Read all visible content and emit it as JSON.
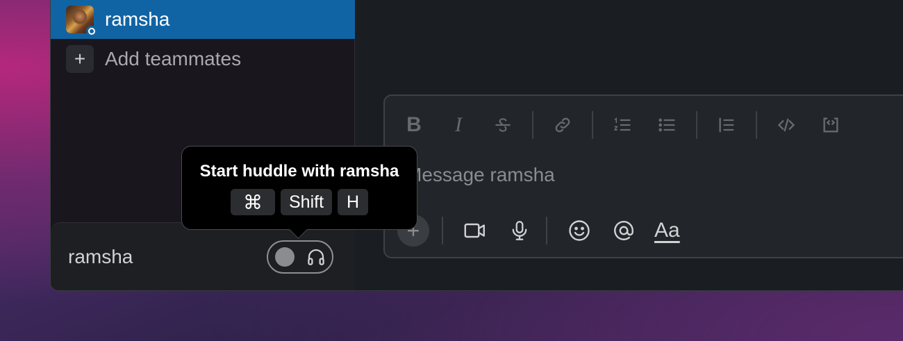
{
  "sidebar": {
    "active_dm": {
      "name": "ramsha"
    },
    "add_teammates_label": "Add teammates",
    "add_icon": "+"
  },
  "footer": {
    "user_name": "ramsha",
    "huddle_toggle_state": "off"
  },
  "tooltip": {
    "title": "Start huddle with ramsha",
    "keys": [
      "⌘",
      "Shift",
      "H"
    ]
  },
  "composer": {
    "placeholder": "Message ramsha",
    "format_tools": [
      "bold-icon",
      "italic-icon",
      "strikethrough-icon",
      "link-icon",
      "ordered-list-icon",
      "bulleted-list-icon",
      "blockquote-icon",
      "code-icon",
      "code-block-icon"
    ],
    "bold_glyph": "B",
    "italic_glyph": "I",
    "plus_glyph": "+",
    "formatting_label": "Aa"
  },
  "colors": {
    "active_item_bg": "#1164a3",
    "sidebar_bg": "#19171d",
    "main_bg": "#1a1d21",
    "tooltip_bg": "#000000"
  }
}
